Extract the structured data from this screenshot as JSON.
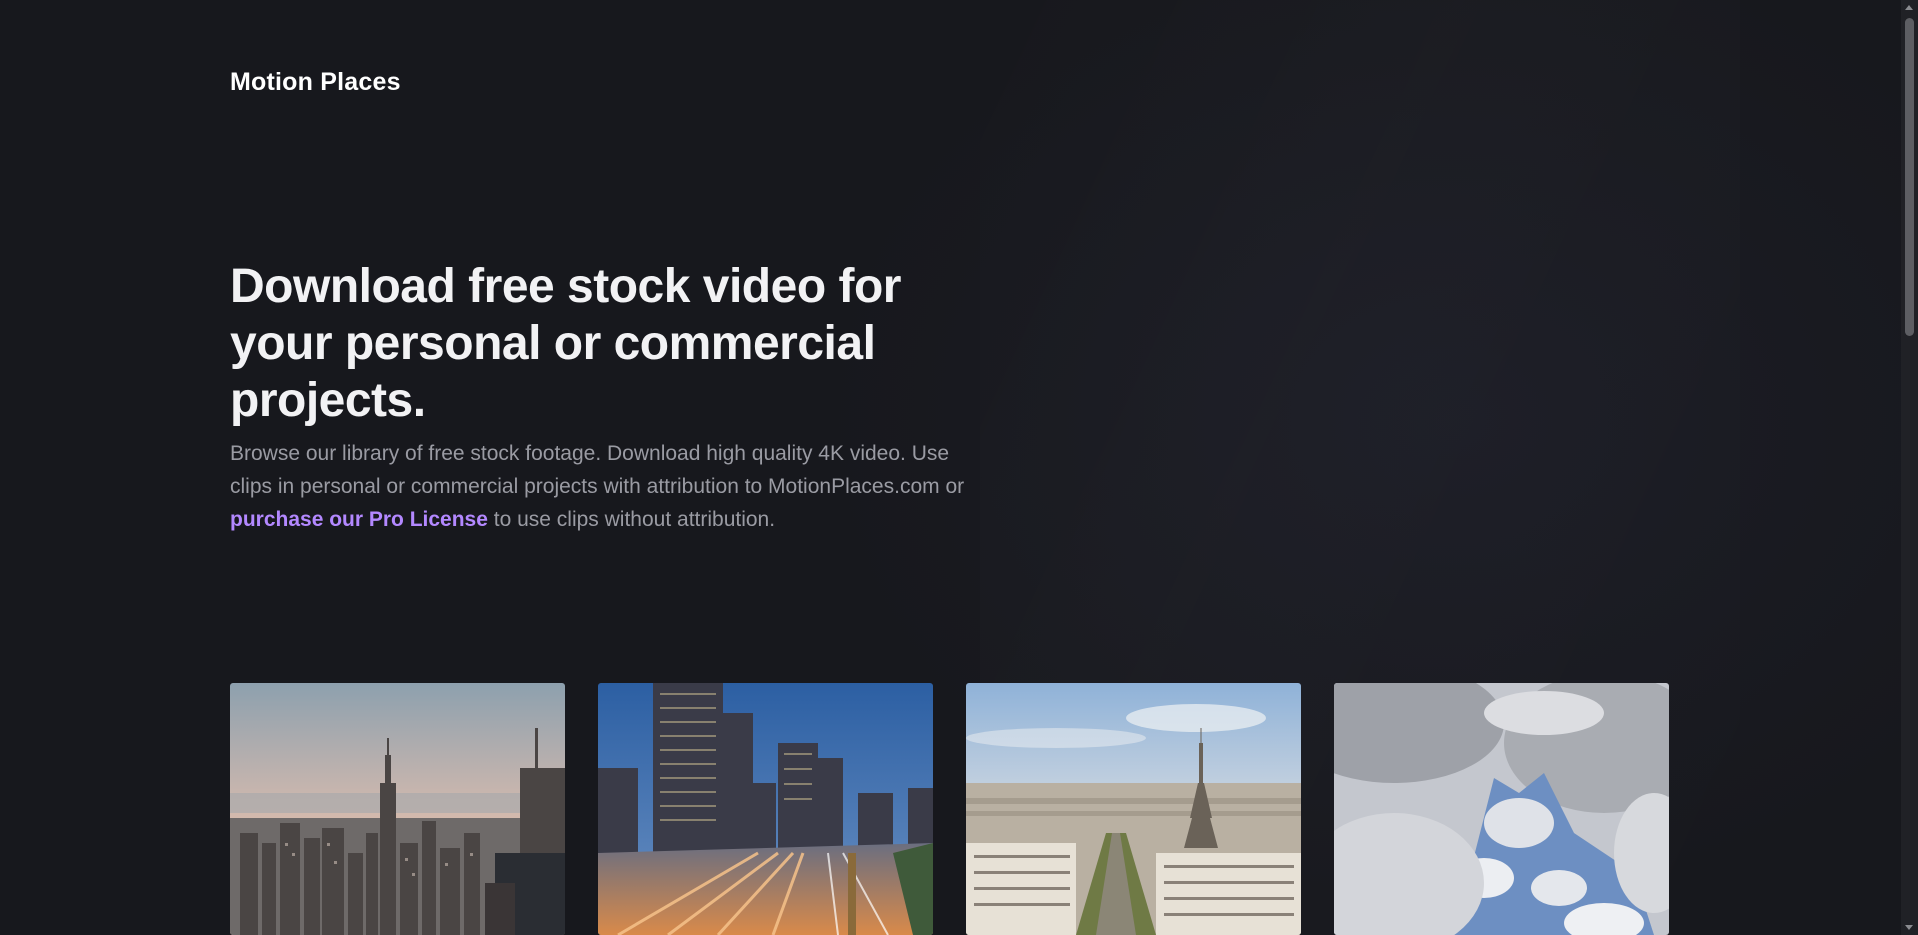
{
  "brand": {
    "name": "Motion Places"
  },
  "hero": {
    "headline": "Download free stock video for your personal or commercial projects.",
    "lead_text_1": "Browse our library of free stock footage. Download high quality 4K video. Use clips in personal or commercial projects with attribution to MotionPlaces.com or ",
    "lead_link": "purchase our Pro License",
    "lead_text_2": " to use clips without attribution.",
    "link_color": "#b388ff"
  },
  "thumbnails": [
    {
      "subject": "new-york-skyline"
    },
    {
      "subject": "city-highway-night"
    },
    {
      "subject": "paris-eiffel-tower"
    },
    {
      "subject": "clouds-sky"
    }
  ],
  "colors": {
    "background": "#17181d",
    "headline": "#f2f2f4",
    "body_text": "#9a9ba3"
  }
}
